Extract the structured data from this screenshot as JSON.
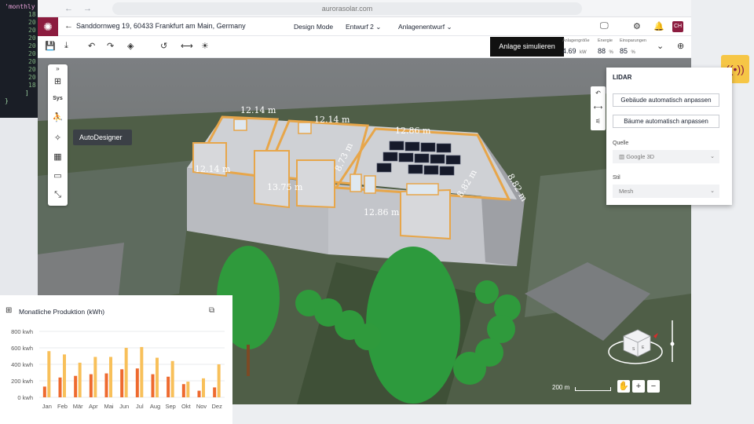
{
  "code_bg": {
    "first_line": "'monthly"
  },
  "browser": {
    "url": "aurorasolar.com"
  },
  "header": {
    "address": "Sanddornweg 19, 60433 Frankfurt am Main, Germany",
    "mode": "Design Mode",
    "draft": "Entwurf 2",
    "system_draft": "Anlagenentwurf",
    "avatar": "CH"
  },
  "toolbar": {
    "simulate_label": "Anlage simulieren",
    "metrics": [
      {
        "label": "Anlagengröße",
        "value": "4.69",
        "unit": "kW"
      },
      {
        "label": "Energie",
        "value": "88",
        "unit": "%"
      },
      {
        "label": "Einsparungen",
        "value": "85",
        "unit": "%"
      }
    ]
  },
  "tool_strip": {
    "sys_label": "Sys",
    "tooltip": "AutoDesigner"
  },
  "roof_measures": [
    "12.14 m",
    "12.14 m",
    "12.86 m",
    "12.14 m",
    "13.75 m",
    "8.73 m",
    "8.82 m",
    "8.82 m",
    "12.86 m"
  ],
  "lidar": {
    "title": "LIDAR",
    "btn_buildings": "Gebäude automatisch anpassen",
    "btn_trees": "Bäume automatisch anpassen",
    "source_label": "Quelle",
    "source_value": "Google 3D",
    "style_label": "Stil",
    "style_value": "Mesh"
  },
  "compass": {
    "scale_label": "200 m"
  },
  "chart": {
    "title": "Monatliche Produktion (kWh)"
  },
  "chart_data": {
    "type": "bar",
    "title": "Monatliche Produktion (kWh)",
    "categories": [
      "Jan",
      "Feb",
      "Mär",
      "Apr",
      "Mai",
      "Jun",
      "Jul",
      "Aug",
      "Sep",
      "Okt",
      "Nov",
      "Dez"
    ],
    "series": [
      {
        "values": [
          130,
          240,
          260,
          280,
          290,
          340,
          350,
          280,
          250,
          160,
          80,
          120
        ]
      },
      {
        "values": [
          560,
          520,
          420,
          490,
          490,
          600,
          610,
          480,
          440,
          190,
          230,
          400
        ]
      }
    ],
    "y_ticks": [
      "0 kwh",
      "200 kwh",
      "400 kwh",
      "600 kwh",
      "800 kwh"
    ],
    "ylim": [
      0,
      800
    ],
    "colors": [
      "#ee6a2f",
      "#f8c05a"
    ],
    "grid": true
  }
}
